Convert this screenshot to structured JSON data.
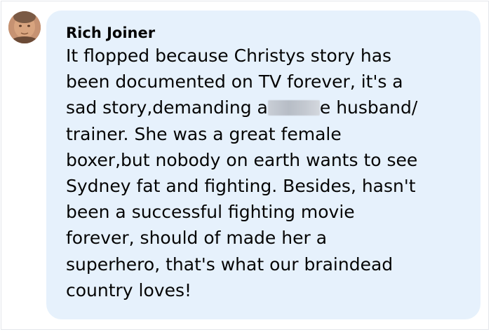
{
  "comment": {
    "author": "Rich Joiner",
    "lines": [
      "It flopped because Christys story has",
      "been documented on TV forever, it's a",
      [
        "sad story,demanding a",
        "e husband/"
      ],
      "trainer. She was a great female",
      "boxer,but nobody on earth wants to see",
      "Sydney fat and fighting. Besides, hasn't",
      "been a successful fighting movie",
      "forever, should of made her a",
      "superhero, that's what our braindead",
      "country loves!"
    ]
  },
  "colors": {
    "bubble_background": "#e6f1fc",
    "text": "#050505",
    "page_background": "#ffffff"
  },
  "icons": {
    "avatar": "user-profile-photo"
  }
}
